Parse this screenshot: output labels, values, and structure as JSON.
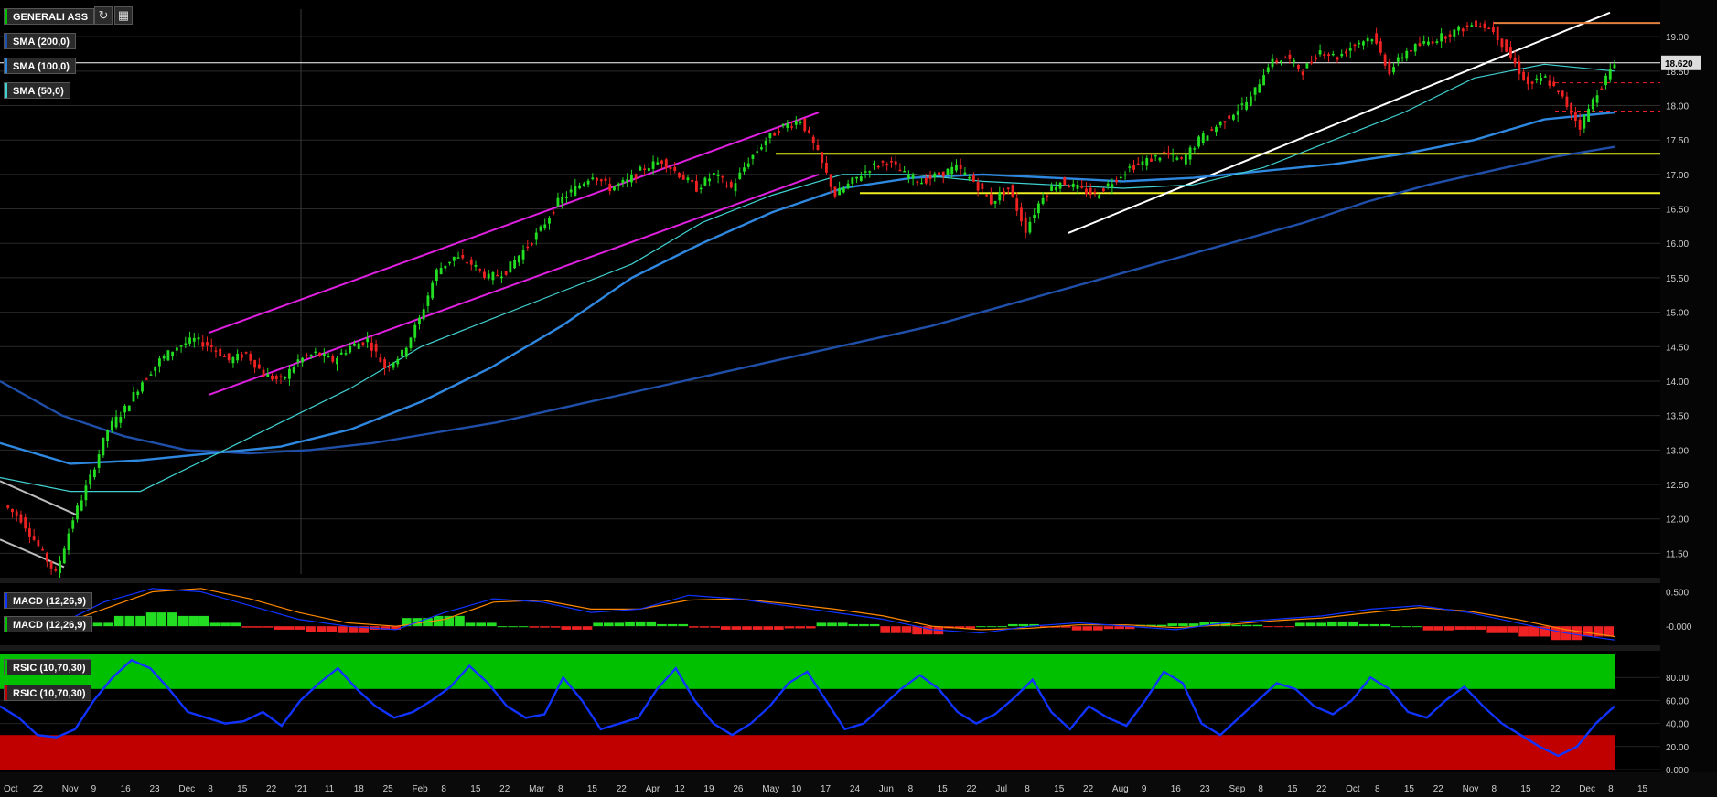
{
  "header": {
    "symbol": "GENERALI ASS",
    "symbol_color": "#00c000",
    "buttons": [
      {
        "icon": "refresh-icon"
      },
      {
        "icon": "chart-settings-icon"
      }
    ],
    "indicators": [
      {
        "label": "SMA (200,0)",
        "color": "#1f4fa8"
      },
      {
        "label": "SMA (100,0)",
        "color": "#2f88e0"
      },
      {
        "label": "SMA (50,0)",
        "color": "#40d0d0"
      }
    ]
  },
  "chart_data": [
    {
      "type": "candlestick",
      "title": "GENERALI ASS",
      "last_price_label": "18.620",
      "y_ticks": [
        "11.50",
        "12.00",
        "12.50",
        "13.00",
        "13.50",
        "14.00",
        "14.50",
        "15.00",
        "15.50",
        "16.00",
        "16.50",
        "17.00",
        "17.50",
        "18.00",
        "18.50",
        "19.00"
      ],
      "ylim": [
        11.2,
        19.4
      ],
      "x_tick_labels": [
        "Oct",
        "22",
        "Nov",
        "9",
        "16",
        "23",
        "Dec",
        "8",
        "15",
        "22",
        "'21",
        "11",
        "18",
        "25",
        "Feb",
        "8",
        "15",
        "22",
        "Mar",
        "8",
        "15",
        "22",
        "Apr",
        "12",
        "19",
        "26",
        "May",
        "10",
        "17",
        "24",
        "Jun",
        "8",
        "15",
        "22",
        "Jul",
        "8",
        "15",
        "22",
        "Aug",
        "9",
        "16",
        "23",
        "Sep",
        "8",
        "15",
        "22",
        "Oct",
        "8",
        "15",
        "22",
        "Nov",
        "8",
        "15",
        "22",
        "Dec",
        "8",
        "15"
      ],
      "close_series": [
        12.2,
        12.0,
        11.6,
        11.2,
        12.0,
        12.6,
        13.3,
        13.6,
        14.0,
        14.3,
        14.5,
        14.6,
        14.5,
        14.3,
        14.4,
        14.1,
        14.0,
        14.3,
        14.4,
        14.3,
        14.5,
        14.6,
        14.2,
        14.4,
        14.9,
        15.6,
        15.8,
        15.7,
        15.5,
        15.6,
        15.9,
        16.2,
        16.6,
        16.8,
        17.0,
        16.8,
        16.9,
        17.1,
        17.2,
        17.0,
        16.8,
        17.0,
        16.8,
        17.2,
        17.5,
        17.7,
        17.8,
        17.3,
        16.7,
        16.9,
        17.1,
        17.2,
        17.0,
        16.9,
        17.0,
        17.1,
        16.9,
        16.6,
        16.8,
        16.2,
        16.7,
        16.9,
        16.8,
        16.7,
        16.9,
        17.1,
        17.2,
        17.3,
        17.2,
        17.5,
        17.7,
        17.9,
        18.1,
        18.6,
        18.7,
        18.5,
        18.8,
        18.7,
        18.9,
        19.0,
        18.5,
        18.8,
        18.9,
        19.0,
        19.1,
        19.2,
        19.1,
        18.7,
        18.3,
        18.4,
        18.1,
        17.7,
        18.2,
        18.6
      ],
      "sma": [
        {
          "name": "SMA (200,0)",
          "color": "#1f4fa8",
          "values": [
            14.0,
            13.5,
            13.2,
            13.0,
            12.95,
            13.0,
            13.1,
            13.25,
            13.4,
            13.6,
            13.8,
            14.0,
            14.2,
            14.4,
            14.6,
            14.8,
            15.05,
            15.3,
            15.55,
            15.8,
            16.05,
            16.3,
            16.6,
            16.85,
            17.05,
            17.25,
            17.4
          ]
        },
        {
          "name": "SMA (100,0)",
          "color": "#2f88e0",
          "values": [
            13.1,
            12.8,
            12.85,
            12.95,
            13.05,
            13.3,
            13.7,
            14.2,
            14.8,
            15.5,
            16.0,
            16.45,
            16.8,
            16.95,
            17.0,
            16.95,
            16.9,
            16.95,
            17.05,
            17.15,
            17.3,
            17.5,
            17.8,
            17.9
          ]
        },
        {
          "name": "SMA (50,0)",
          "color": "#40d0d0",
          "values": [
            12.6,
            12.4,
            12.4,
            12.9,
            13.4,
            13.9,
            14.5,
            14.9,
            15.3,
            15.7,
            16.3,
            16.7,
            17.0,
            17.0,
            16.9,
            16.85,
            16.8,
            16.85,
            17.1,
            17.5,
            17.9,
            18.4,
            18.6,
            18.5
          ]
        }
      ]
    },
    {
      "type": "macd",
      "label": "MACD (12,26,9)",
      "label2": "MACD (12,26,9)",
      "y_ticks": [
        "0.500",
        "-0.000"
      ],
      "ylim": [
        -0.25,
        0.6
      ],
      "histogram": [
        0.05,
        0.15,
        0.2,
        0.15,
        0.05,
        -0.02,
        -0.05,
        -0.08,
        -0.1,
        -0.05,
        0.12,
        0.15,
        0.05,
        0.0,
        -0.02,
        -0.05,
        0.05,
        0.07,
        0.03,
        -0.02,
        -0.05,
        -0.05,
        -0.03,
        0.05,
        0.03,
        -0.1,
        -0.12,
        -0.03,
        0.0,
        0.03,
        -0.02,
        -0.06,
        -0.04,
        0.02,
        0.04,
        0.06,
        0.02,
        -0.01,
        0.05,
        0.07,
        0.03,
        0.0,
        -0.06,
        -0.05,
        -0.1,
        -0.15,
        -0.2,
        -0.15
      ],
      "macd_line": [
        0.0,
        0.35,
        0.55,
        0.5,
        0.3,
        0.1,
        0.0,
        -0.05,
        0.2,
        0.4,
        0.35,
        0.2,
        0.25,
        0.45,
        0.4,
        0.3,
        0.2,
        0.1,
        -0.05,
        -0.1,
        0.0,
        0.05,
        0.0,
        -0.05,
        0.05,
        0.1,
        0.15,
        0.25,
        0.3,
        0.2,
        0.05,
        -0.1,
        -0.2
      ],
      "signal_line": [
        0.0,
        0.25,
        0.5,
        0.55,
        0.4,
        0.2,
        0.05,
        0.0,
        0.1,
        0.35,
        0.38,
        0.25,
        0.25,
        0.38,
        0.4,
        0.33,
        0.25,
        0.15,
        0.0,
        -0.05,
        -0.03,
        0.02,
        0.02,
        -0.02,
        0.02,
        0.08,
        0.12,
        0.2,
        0.27,
        0.22,
        0.1,
        -0.05,
        -0.15
      ],
      "colors": {
        "up": "#22dd22",
        "down": "#ee2222",
        "line": "#1133ff",
        "signal": "#ff8800"
      }
    },
    {
      "type": "rsi",
      "label": "RSIC (10,70,30)",
      "label2": "RSIC (10,70,30)",
      "y_ticks": [
        "80.00",
        "60.00",
        "40.00",
        "20.00",
        "0.000"
      ],
      "ylim": [
        0,
        100
      ],
      "overbought": 70,
      "oversold": 30,
      "values": [
        55,
        45,
        30,
        28,
        35,
        60,
        80,
        95,
        88,
        70,
        50,
        45,
        40,
        42,
        50,
        38,
        60,
        75,
        88,
        70,
        55,
        45,
        50,
        60,
        72,
        90,
        75,
        55,
        45,
        48,
        80,
        60,
        35,
        40,
        45,
        70,
        88,
        60,
        40,
        30,
        40,
        55,
        75,
        85,
        60,
        35,
        40,
        55,
        70,
        82,
        70,
        50,
        40,
        48,
        62,
        78,
        50,
        35,
        55,
        45,
        38,
        60,
        85,
        75,
        40,
        30,
        45,
        60,
        75,
        70,
        55,
        48,
        60,
        80,
        70,
        50,
        45,
        60,
        72,
        55,
        40,
        30,
        20,
        12,
        20,
        40,
        55
      ],
      "colors": {
        "line": "#1133ff",
        "zone_high": "#00c000",
        "zone_low": "#c00000"
      }
    }
  ]
}
